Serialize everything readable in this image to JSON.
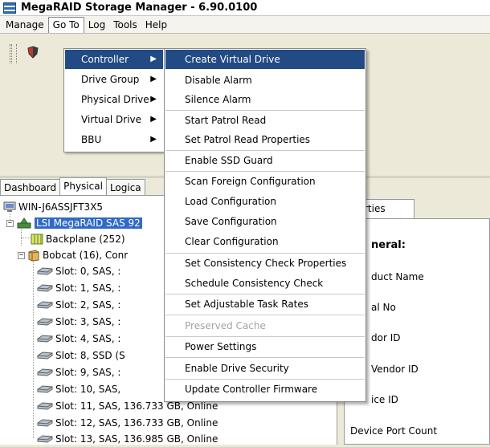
{
  "window": {
    "title": "MegaRAID Storage Manager - 6.90.0100"
  },
  "menubar": [
    "Manage",
    "Go To",
    "Log",
    "Tools",
    "Help"
  ],
  "tabs": [
    "Dashboard",
    "Physical",
    "Logica"
  ],
  "tree": {
    "host": "WIN-J6ASSJFT3X5",
    "controller": "LSI MegaRAID SAS 92",
    "backplane": "Backplane (252)",
    "enclosure": "Bobcat (16), Conr",
    "slots": [
      "Slot: 0, SAS, :",
      "Slot: 1, SAS, :",
      "Slot: 2, SAS, :",
      "Slot: 3, SAS, :",
      "Slot: 4, SAS, :",
      "Slot: 8, SSD (S",
      "Slot: 9, SAS, :",
      "Slot: 10, SAS,",
      "Slot: 11, SAS, 136.733 GB, Online",
      "Slot: 12, SAS, 136.733 GB, Online",
      "Slot: 13, SAS, 136.985 GB, Online"
    ]
  },
  "properties": {
    "tab": "rties",
    "heading": "neral:",
    "labels": [
      "duct Name",
      "al No",
      "dor ID",
      "Vendor ID",
      "ice ID",
      "Device Port Count"
    ]
  },
  "goto_menu": [
    "Controller",
    "Drive Group",
    "Physical Drive",
    "Virtual Drive",
    "BBU"
  ],
  "controller_submenu": [
    "Create Virtual Drive",
    "Disable Alarm",
    "Silence Alarm",
    "Start Patrol Read",
    "Set Patrol Read Properties",
    "Enable SSD Guard",
    "Scan Foreign Configuration",
    "Load Configuration",
    "Save Configuration",
    "Clear Configuration",
    "Set Consistency Check Properties",
    "Schedule Consistency Check",
    "Set Adjustable Task Rates",
    "Preserved Cache",
    "Power Settings",
    "Enable Drive Security",
    "Update Controller Firmware"
  ],
  "icons": {
    "arrow": "▶",
    "expand": "+",
    "collapse": "−"
  },
  "colors": {
    "highlight": "#224b85",
    "disabled": "#a3a3a3"
  }
}
